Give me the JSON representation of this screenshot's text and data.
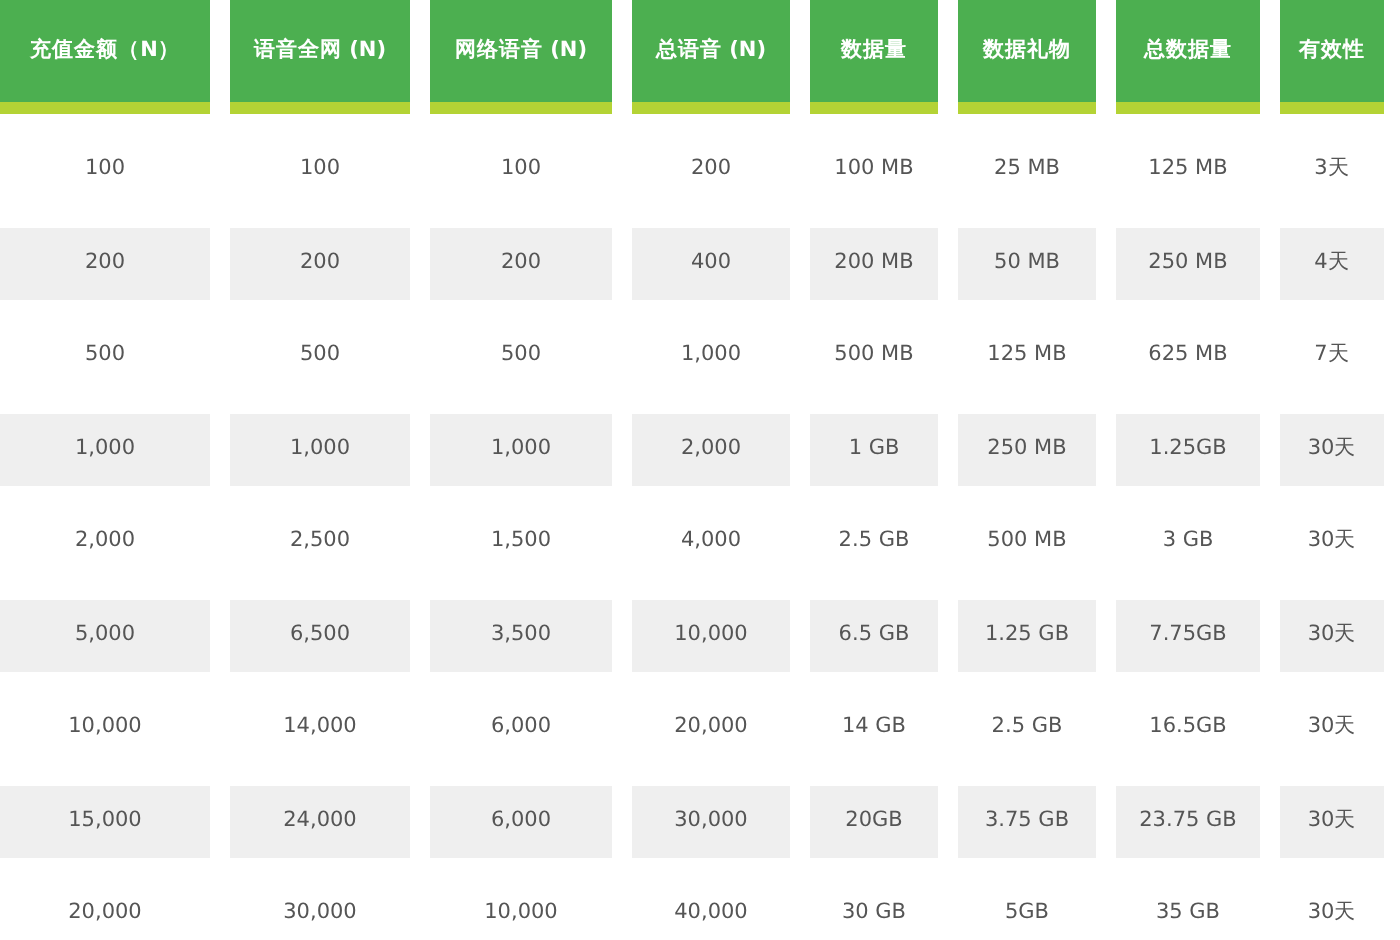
{
  "table": {
    "columns": [
      "充值金额（N）",
      "语音全网 (N)",
      "网络语音 (N)",
      "总语音 (N)",
      "数据量",
      "数据礼物",
      "总数据量",
      "有效性"
    ],
    "rows": [
      [
        "100",
        "100",
        "100",
        "200",
        "100 MB",
        "25 MB",
        "125 MB",
        "3天"
      ],
      [
        "200",
        "200",
        "200",
        "400",
        "200 MB",
        "50 MB",
        "250 MB",
        "4天"
      ],
      [
        "500",
        "500",
        "500",
        "1,000",
        "500 MB",
        "125 MB",
        "625 MB",
        "7天"
      ],
      [
        "1,000",
        "1,000",
        "1,000",
        "2,000",
        "1 GB",
        "250 MB",
        "1.25GB",
        "30天"
      ],
      [
        "2,000",
        "2,500",
        "1,500",
        "4,000",
        "2.5 GB",
        "500 MB",
        "3 GB",
        "30天"
      ],
      [
        "5,000",
        "6,500",
        "3,500",
        "10,000",
        "6.5 GB",
        "1.25 GB",
        "7.75GB",
        "30天"
      ],
      [
        "10,000",
        "14,000",
        "6,000",
        "20,000",
        "14 GB",
        "2.5 GB",
        "16.5GB",
        "30天"
      ],
      [
        "15,000",
        "24,000",
        "6,000",
        "30,000",
        "20GB",
        "3.75 GB",
        "23.75 GB",
        "30天"
      ],
      [
        "20,000",
        "30,000",
        "10,000",
        "40,000",
        "30 GB",
        "5GB",
        "35 GB",
        "30天"
      ]
    ]
  }
}
